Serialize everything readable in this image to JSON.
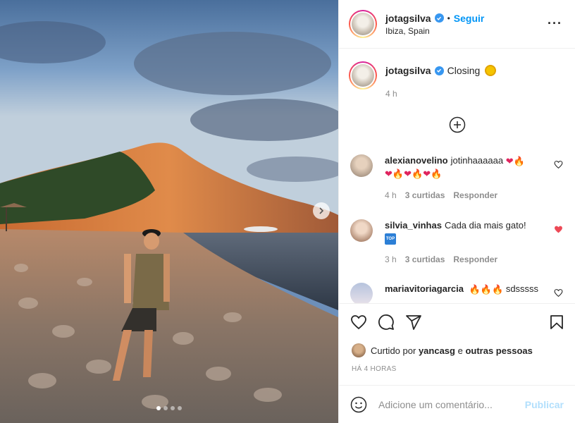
{
  "post": {
    "author": {
      "username": "jotagsilva",
      "verified": true,
      "follow_label": "Seguir",
      "separator": "•",
      "location": "Ibiza, Spain"
    },
    "more_icon": "more-horizontal-icon",
    "carousel": {
      "slide_count": 4,
      "active_index": 0,
      "next_icon": "chevron-right-icon"
    },
    "caption": {
      "username": "jotagsilva",
      "text": "Closing",
      "emoji": "sun-emoji",
      "time": "4 h"
    },
    "load_more_icon": "plus-circle-icon",
    "comments": [
      {
        "username": "alexianovelino",
        "text": "jotinhaaaaaa",
        "emoji_line1": [
          "red-heart",
          "fire"
        ],
        "emoji_line2": [
          "red-heart",
          "fire",
          "red-heart",
          "fire",
          "red-heart",
          "fire"
        ],
        "time": "4 h",
        "likes": "3 curtidas",
        "reply": "Responder",
        "liked": false
      },
      {
        "username": "silvia_vinhas",
        "text": "Cada dia mais gato!",
        "badge": "TOP",
        "time": "3 h",
        "likes": "3 curtidas",
        "reply": "Responder",
        "liked": true
      },
      {
        "username": "mariavitoriagarcia",
        "emoji_prefix": [
          "fire",
          "fire",
          "fire"
        ],
        "text": "sdsssss",
        "liked": false
      }
    ],
    "actions": {
      "like_icon": "heart-icon",
      "comment_icon": "comment-icon",
      "share_icon": "paper-plane-icon",
      "save_icon": "bookmark-icon"
    },
    "likes_summary": {
      "prefix": "Curtido por",
      "user": "yancasg",
      "conjunction": "e",
      "others": "outras pessoas"
    },
    "timestamp": "HÁ 4 HORAS",
    "add_comment": {
      "placeholder": "Adicione um comentário...",
      "publish_label": "Publicar",
      "emoji_icon": "smiley-icon"
    }
  },
  "colors": {
    "accent": "#0095f6",
    "liked_heart": "#ed4956",
    "verified": "#3897f0",
    "muted_text": "#8e8e8e",
    "publish_disabled": "#b2dffc"
  }
}
